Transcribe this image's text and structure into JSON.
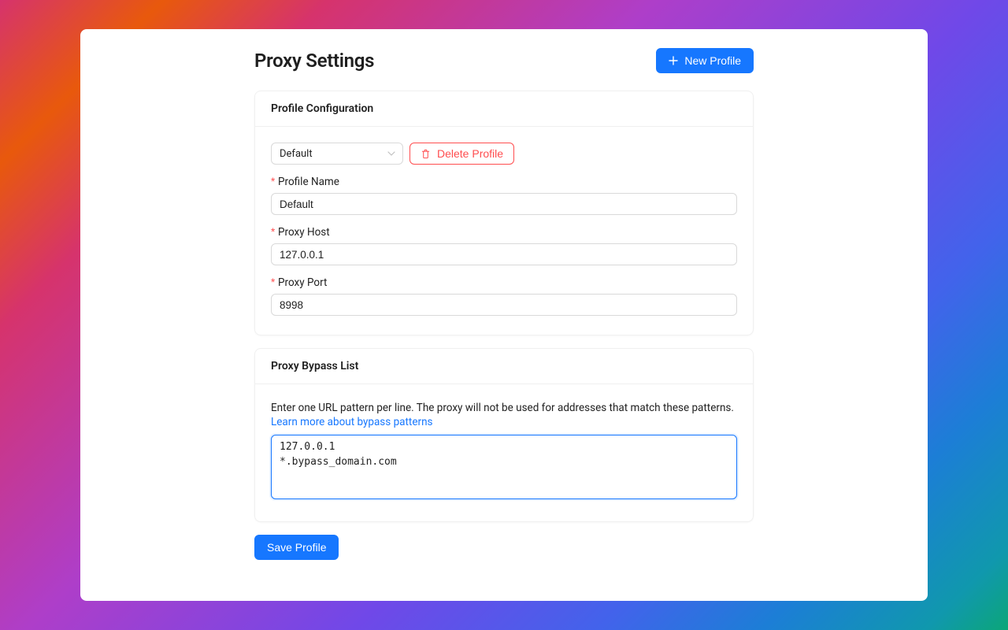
{
  "header": {
    "title": "Proxy Settings",
    "newProfileLabel": "New Profile"
  },
  "profileCard": {
    "title": "Profile Configuration",
    "profileSelect": {
      "selected": "Default"
    },
    "deleteLabel": "Delete Profile",
    "fields": {
      "name": {
        "label": "Profile Name",
        "value": "Default"
      },
      "host": {
        "label": "Proxy Host",
        "value": "127.0.0.1"
      },
      "port": {
        "label": "Proxy Port",
        "value": "8998"
      }
    }
  },
  "bypassCard": {
    "title": "Proxy Bypass List",
    "hint": "Enter one URL pattern per line. The proxy will not be used for addresses that match these patterns.",
    "learnMore": "Learn more about bypass patterns",
    "value": "127.0.0.1\n*.bypass_domain.com"
  },
  "saveLabel": "Save Profile"
}
